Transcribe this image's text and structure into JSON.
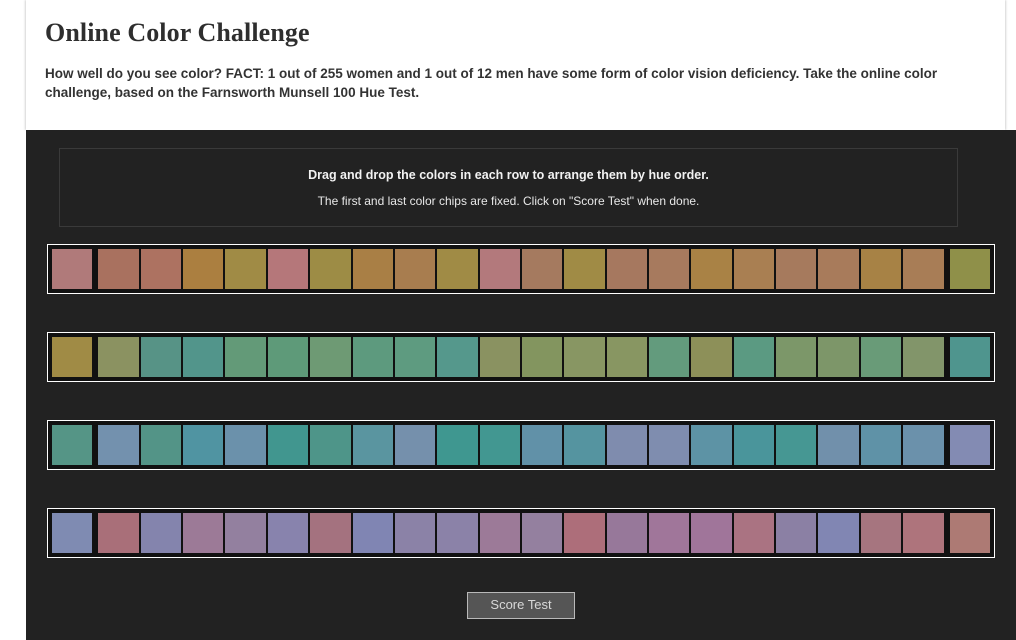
{
  "header": {
    "title": "Online Color Challenge",
    "intro": "How well do you see color? FACT: 1 out of 255 women and 1 out of 12 men have some form of color vision deficiency. Take the online color challenge, based on the Farnsworth Munsell 100 Hue Test."
  },
  "instructions": {
    "line1": "Drag and drop the colors in each row to arrange them by hue order.",
    "line2": "The first and last color chips are fixed. Click on \"Score Test\" when done."
  },
  "controls": {
    "score_test_label": "Score Test"
  },
  "theme": {
    "page_background": "#ffffff",
    "test_background": "#222222",
    "row_border": "#ffffff",
    "row_inner": "#111111",
    "button_background": "#555555",
    "button_text": "#d8d8d8",
    "button_border": "#b9b9b9",
    "heading_color": "#2e2e2e",
    "body_text_color": "#333333",
    "instruction_text_color": "#f2f2f2",
    "instruction_box_border": "#3a3a3a"
  },
  "chart_data": {
    "type": "table",
    "title": "Farnsworth Munsell 100 Hue Test color chip rows",
    "rows": 4,
    "chips_per_row": 22,
    "fixed_positions": [
      0,
      21
    ],
    "series": [
      {
        "name": "row-1",
        "values": [
          "#b07a7a",
          "#a9715f",
          "#ad7261",
          "#ab7f40",
          "#a08b45",
          "#b5777a",
          "#9d8c45",
          "#a97f45",
          "#a87d4f",
          "#a08b45",
          "#b3797c",
          "#a57a5f",
          "#a08b45",
          "#a6785f",
          "#a77a5e",
          "#a98245",
          "#a97f52",
          "#a67a5d",
          "#a87b5b",
          "#a78245",
          "#a87d56",
          "#8f9049"
        ]
      },
      {
        "name": "row-2",
        "values": [
          "#a08b45",
          "#8b9261",
          "#579386",
          "#52958b",
          "#639a78",
          "#5e9a79",
          "#6e9a74",
          "#5d9a7e",
          "#5e9b80",
          "#55988c",
          "#8a9261",
          "#83955f",
          "#889663",
          "#889662",
          "#639b7d",
          "#8d9059",
          "#5b9a82",
          "#7c9769",
          "#7d9669",
          "#699b78",
          "#82956a",
          "#4f958e"
        ]
      },
      {
        "name": "row-3",
        "values": [
          "#559586",
          "#7391ae",
          "#539487",
          "#5094a2",
          "#6b91ab",
          "#41968f",
          "#4e9589",
          "#5a95a0",
          "#7590ac",
          "#3f9790",
          "#429791",
          "#6191a8",
          "#5594a0",
          "#7f8cae",
          "#7f8daf",
          "#5d93a5",
          "#4a959b",
          "#469793",
          "#7190ab",
          "#5f92a7",
          "#6b91ab",
          "#838bb3"
        ]
      },
      {
        "name": "row-4",
        "values": [
          "#7f8bb2",
          "#a96f79",
          "#8484ad",
          "#9c7a97",
          "#93809f",
          "#8883ad",
          "#a4727f",
          "#8085b3",
          "#8b82a7",
          "#8b82a8",
          "#9c7a98",
          "#94809f",
          "#ad6e7a",
          "#97789a",
          "#a0769a",
          "#a0759a",
          "#aa7382",
          "#8b80a4",
          "#8186b3",
          "#a6757f",
          "#ae747c",
          "#ad7a74"
        ]
      }
    ]
  }
}
